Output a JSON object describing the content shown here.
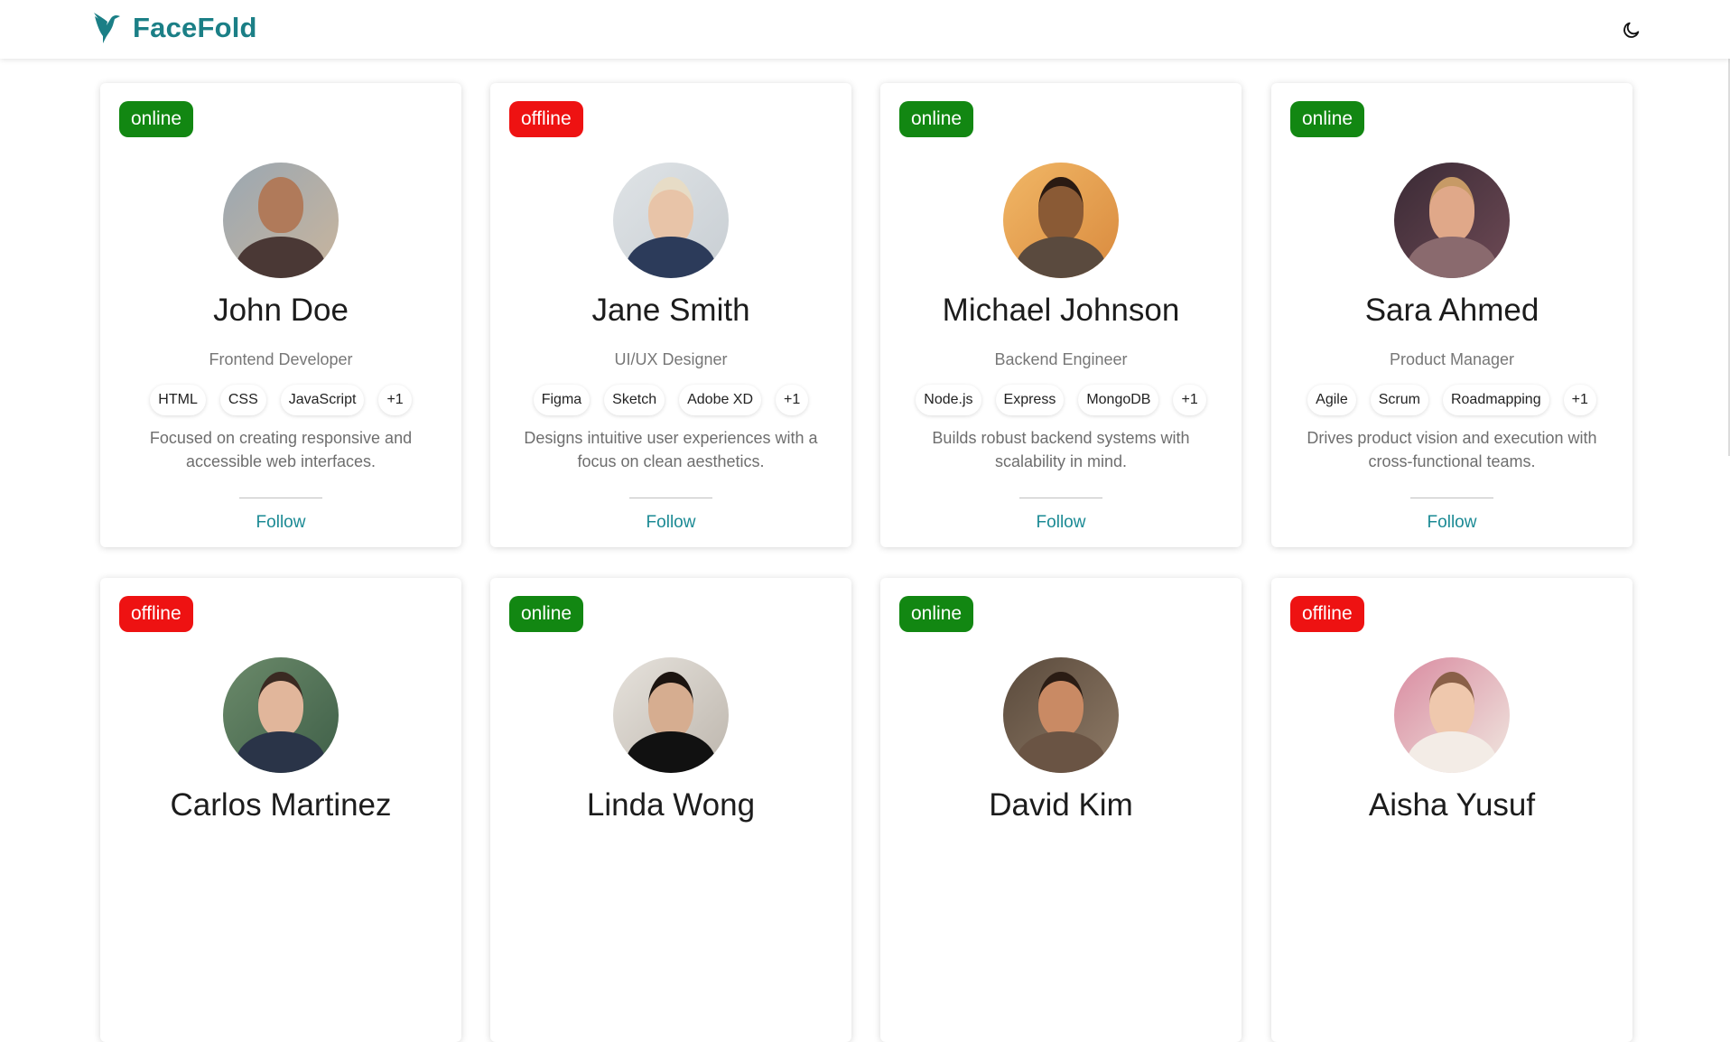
{
  "header": {
    "brand": "FaceFold"
  },
  "cards": [
    {
      "status": "online",
      "name": "John Doe",
      "role": "Frontend Developer",
      "skills": [
        "HTML",
        "CSS",
        "JavaScript",
        "+1"
      ],
      "bio": "Focused on creating responsive and accessible web interfaces.",
      "follow": "Follow"
    },
    {
      "status": "offline",
      "name": "Jane Smith",
      "role": "UI/UX Designer",
      "skills": [
        "Figma",
        "Sketch",
        "Adobe XD",
        "+1"
      ],
      "bio": "Designs intuitive user experiences with a focus on clean aesthetics.",
      "follow": "Follow"
    },
    {
      "status": "online",
      "name": "Michael Johnson",
      "role": "Backend Engineer",
      "skills": [
        "Node.js",
        "Express",
        "MongoDB",
        "+1"
      ],
      "bio": "Builds robust backend systems with scalability in mind.",
      "follow": "Follow"
    },
    {
      "status": "online",
      "name": "Sara Ahmed",
      "role": "Product Manager",
      "skills": [
        "Agile",
        "Scrum",
        "Roadmapping",
        "+1"
      ],
      "bio": "Drives product vision and execution with cross-functional teams.",
      "follow": "Follow"
    },
    {
      "status": "offline",
      "name": "Carlos Martinez",
      "role": "",
      "skills": [],
      "bio": "",
      "follow": ""
    },
    {
      "status": "online",
      "name": "Linda Wong",
      "role": "",
      "skills": [],
      "bio": "",
      "follow": ""
    },
    {
      "status": "online",
      "name": "David Kim",
      "role": "",
      "skills": [],
      "bio": "",
      "follow": ""
    },
    {
      "status": "offline",
      "name": "Aisha Yusuf",
      "role": "",
      "skills": [],
      "bio": "",
      "follow": ""
    }
  ],
  "colors": {
    "brand": "#1b7f86",
    "online": "#128712",
    "offline": "#ee1212",
    "follow": "#1b8a94"
  },
  "icons": {
    "logo": "hummingbird-icon",
    "theme_toggle": "moon-icon"
  }
}
